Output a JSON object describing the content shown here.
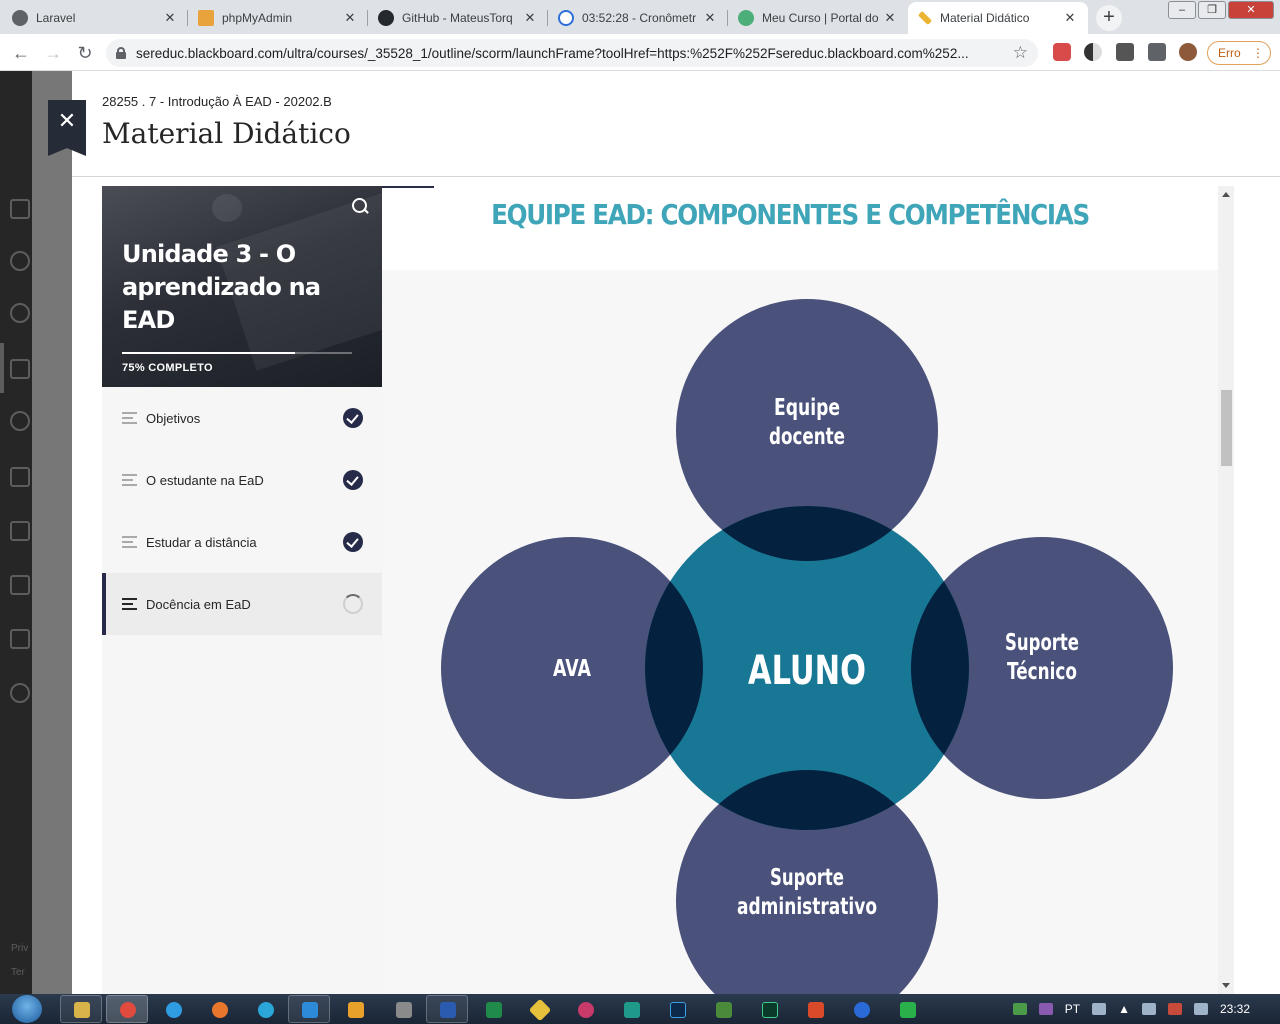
{
  "browser": {
    "tabs": [
      {
        "title": "Laravel",
        "icon": "laravel-icon",
        "color": "#5f6368"
      },
      {
        "title": "phpMyAdmin",
        "icon": "phpmyadmin-icon",
        "color": "#e8a33c"
      },
      {
        "title": "GitHub - MateusTorq",
        "icon": "github-icon",
        "color": "#24292e"
      },
      {
        "title": "03:52:28 - Cronômetr",
        "icon": "stopwatch-icon",
        "color": "#2f6fd6"
      },
      {
        "title": "Meu Curso | Portal do",
        "icon": "portal-icon",
        "color": "#4caf7a"
      },
      {
        "title": "Material Didático",
        "icon": "pencil-icon",
        "color": "#e9b533"
      }
    ],
    "new_tab": "+",
    "url": "sereduc.blackboard.com/ultra/courses/_35528_1/outline/scorm/launchFrame?toolHref=https:%252F%252Fsereduc.blackboard.com%252...",
    "error_button": "Erro"
  },
  "panel": {
    "breadcrumb": "28255 . 7 - Introdução À EAD - 20202.B",
    "title": "Material Didático"
  },
  "unit": {
    "title": "Unidade 3 - O aprendizado na EAD",
    "progress_label": "75% COMPLETO",
    "progress": 0.75
  },
  "outline": {
    "items": [
      {
        "label": "Objetivos",
        "status": "complete"
      },
      {
        "label": "O estudante na EaD",
        "status": "complete"
      },
      {
        "label": "Estudar a distância",
        "status": "complete"
      },
      {
        "label": "Docência em EaD",
        "status": "in-progress"
      }
    ]
  },
  "content": {
    "heading": "EQUIPE EAD: COMPONENTES E COMPETÊNCIAS",
    "diagram": {
      "center": "ALUNO",
      "top": [
        "Equipe",
        "docente"
      ],
      "left": [
        "AVA"
      ],
      "right": [
        "Suporte",
        "Técnico"
      ],
      "bottom": [
        "Suporte",
        "administrativo"
      ]
    }
  },
  "colors": {
    "outer_circle": "#4a517a",
    "center_circle": "#177794",
    "overlap": "#04213f",
    "heading": "#3fa5b8",
    "accent_dark": "#262b4a"
  },
  "lms_nav": {
    "footer": [
      "Priv",
      "Ter"
    ]
  },
  "taskbar": {
    "language": "PT",
    "clock": "23:32"
  }
}
